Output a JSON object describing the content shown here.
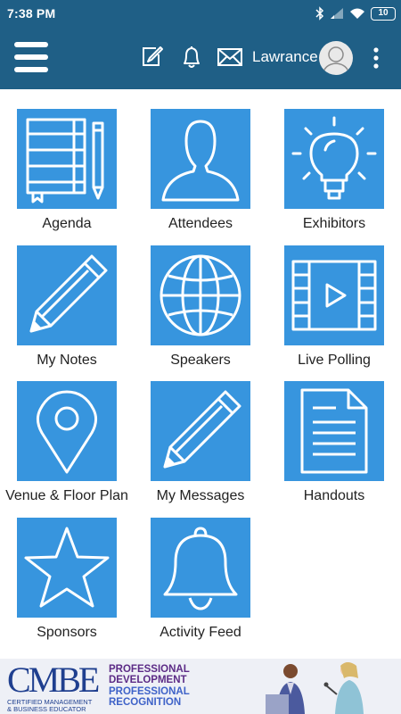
{
  "status_bar": {
    "time": "7:38 PM",
    "battery": "10"
  },
  "app_bar": {
    "user_name": "Lawrance"
  },
  "tiles": [
    {
      "label": "Agenda",
      "icon": "notebook-pencil-icon"
    },
    {
      "label": "Attendees",
      "icon": "person-icon"
    },
    {
      "label": "Exhibitors",
      "icon": "lightbulb-icon"
    },
    {
      "label": "My Notes",
      "icon": "pencil-icon"
    },
    {
      "label": "Speakers",
      "icon": "globe-icon"
    },
    {
      "label": "Live Polling",
      "icon": "video-film-icon"
    },
    {
      "label": "Venue & Floor Plan",
      "icon": "map-pin-icon"
    },
    {
      "label": "My Messages",
      "icon": "pencil-icon"
    },
    {
      "label": "Handouts",
      "icon": "document-icon"
    },
    {
      "label": "Sponsors",
      "icon": "star-icon"
    },
    {
      "label": "Activity Feed",
      "icon": "bell-icon"
    }
  ],
  "banner": {
    "logo": "CMBE",
    "logo_sub1": "CERTIFIED MANAGEMENT",
    "logo_sub2": "& BUSINESS EDUCATOR",
    "line1": "PROFESSIONAL",
    "line2": "DEVELOPMENT",
    "line3": "PROFESSIONAL",
    "line4": "RECOGNITION"
  },
  "colors": {
    "header": "#1f5f86",
    "tile": "#3795de",
    "label": "#222222"
  }
}
